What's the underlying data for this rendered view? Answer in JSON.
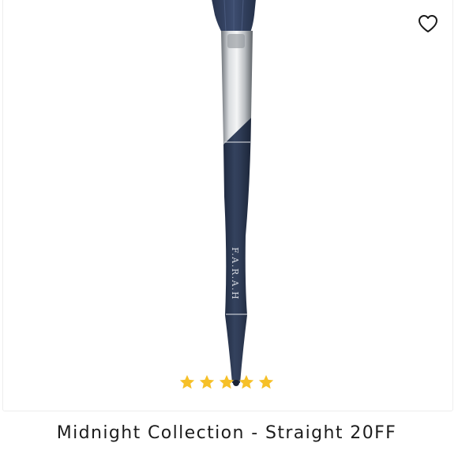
{
  "product": {
    "title": "Midnight Collection - Straight 20FF",
    "brand_imprint": "F.A.R.A.H",
    "rating": 5,
    "rating_max": 5
  },
  "icons": {
    "wishlist": "heart-outline-icon",
    "rating": "star-icon"
  },
  "colors": {
    "star": "#f6c028",
    "handle": "#2b3852",
    "bristles": "#334262",
    "ferrule": "#a9adb2",
    "title_text": "#1c1c1c"
  }
}
